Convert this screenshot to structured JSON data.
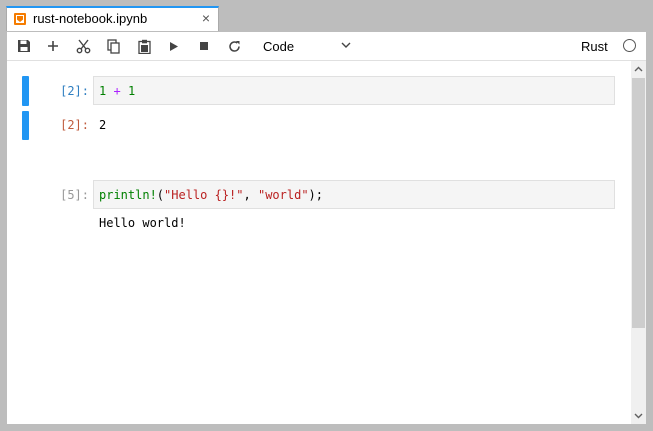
{
  "tab": {
    "title": "rust-notebook.ipynb",
    "close_label": "×",
    "icon": "notebook-icon"
  },
  "toolbar": {
    "buttons": [
      "save-icon",
      "add-icon",
      "cut-icon",
      "copy-icon",
      "paste-icon",
      "run-icon",
      "stop-icon",
      "restart-icon"
    ],
    "cell_type": "Code",
    "kernel_name": "Rust",
    "kernel_status": "idle"
  },
  "cells": [
    {
      "input_prompt": "[2]:",
      "source": "1 + 1",
      "output_prompt": "[2]:",
      "output": "2"
    },
    {
      "input_prompt": "[5]:",
      "source": "println!(\"Hello {}!\", \"world\");",
      "output": "Hello world!"
    }
  ],
  "colors": {
    "accent": "#2196f3",
    "prompt_in": "#307fc1",
    "prompt_out": "#bf5b3d",
    "prompt_idle": "#999999",
    "string": "#ba2121",
    "number": "#008000",
    "operator": "#aa22ff"
  }
}
